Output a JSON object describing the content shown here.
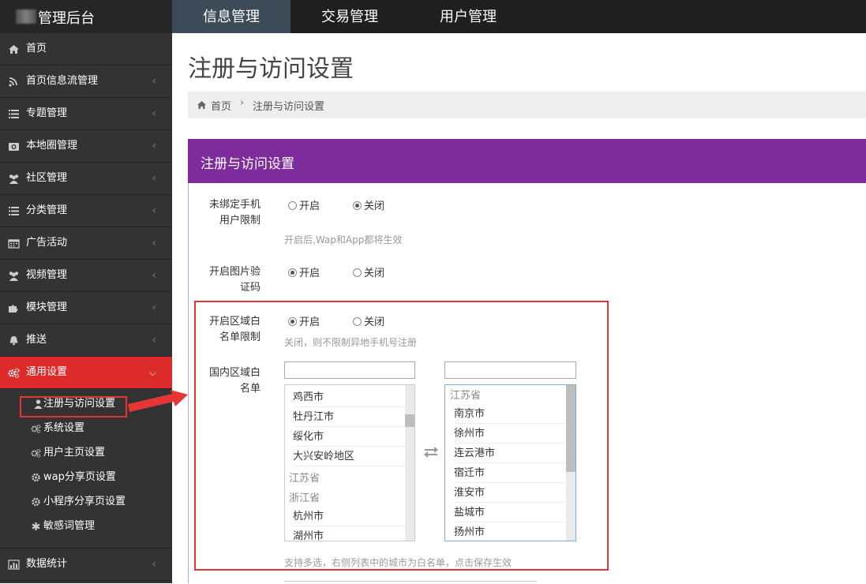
{
  "brand": {
    "title": "管理后台"
  },
  "topnav": [
    {
      "label": "信息管理",
      "active": true
    },
    {
      "label": "交易管理",
      "active": false
    },
    {
      "label": "用户管理",
      "active": false
    }
  ],
  "sidebar": {
    "items": [
      {
        "label": "首页",
        "icon": "home-icon"
      },
      {
        "label": "首页信息流管理",
        "icon": "rss-icon"
      },
      {
        "label": "专题管理",
        "icon": "list-icon"
      },
      {
        "label": "本地圈管理",
        "icon": "camera-icon"
      },
      {
        "label": "社区管理",
        "icon": "users-icon"
      },
      {
        "label": "分类管理",
        "icon": "list-icon"
      },
      {
        "label": "广告活动",
        "icon": "calendar-icon"
      },
      {
        "label": "视频管理",
        "icon": "users-icon"
      },
      {
        "label": "模块管理",
        "icon": "puzzle-icon"
      },
      {
        "label": "推送",
        "icon": "bell-icon"
      },
      {
        "label": "通用设置",
        "icon": "gears-icon",
        "active": true
      }
    ],
    "subitems": [
      {
        "label": "注册与访问设置",
        "icon": "user-icon",
        "current": true
      },
      {
        "label": "系统设置",
        "icon": "gears-icon"
      },
      {
        "label": "用户主页设置",
        "icon": "gears-icon"
      },
      {
        "label": "wap分享页设置",
        "icon": "gear-icon"
      },
      {
        "label": "小程序分享页设置",
        "icon": "gear-icon"
      },
      {
        "label": "敏感词管理",
        "icon": "asterisk-icon"
      }
    ],
    "bottom_item": {
      "label": "数据统计",
      "icon": "bar-chart-icon"
    }
  },
  "page": {
    "title": "注册与访问设置",
    "breadcrumb": {
      "home": "首页",
      "separator": "›",
      "current": "注册与访问设置"
    },
    "panel_title": "注册与访问设置"
  },
  "form": {
    "unbound_phone": {
      "label_line1": "未绑定手机",
      "label_line2": "用户限制",
      "options": [
        "开启",
        "关闭"
      ],
      "selected": "关闭",
      "hint": "开启后,Wap和App都将生效"
    },
    "captcha": {
      "label_line1": "开启图片验",
      "label_line2": "证码",
      "options": [
        "开启",
        "关闭"
      ],
      "selected": "开启"
    },
    "region_whitelist": {
      "label_line1": "开启区域白",
      "label_line2": "名单限制",
      "options": [
        "开启",
        "关闭"
      ],
      "selected": "开启",
      "hint": "关闭，则不限制异地手机号注册"
    },
    "domestic_whitelist": {
      "label_line1": "国内区域白",
      "label_line2": "名单",
      "left_list": [
        {
          "text": "鸡西市",
          "group": false
        },
        {
          "text": "牡丹江市",
          "group": false
        },
        {
          "text": "绥化市",
          "group": false
        },
        {
          "text": "大兴安岭地区",
          "group": false
        },
        {
          "text": "江苏省",
          "group": true
        },
        {
          "text": "浙江省",
          "group": true
        },
        {
          "text": "杭州市",
          "group": false
        },
        {
          "text": "湖州市",
          "group": false
        }
      ],
      "right_list": [
        {
          "text": "江苏省",
          "group": true
        },
        {
          "text": "南京市",
          "group": false
        },
        {
          "text": "徐州市",
          "group": false
        },
        {
          "text": "连云港市",
          "group": false
        },
        {
          "text": "宿迁市",
          "group": false
        },
        {
          "text": "淮安市",
          "group": false
        },
        {
          "text": "盐城市",
          "group": false
        },
        {
          "text": "扬州市",
          "group": false
        }
      ],
      "hint": "支持多选，右侧列表中的城市为白名单，点击保存生效"
    }
  },
  "colors": {
    "topbar": "#1f1f1f",
    "topnav_active": "#3d4b59",
    "sidebar": "#333333",
    "sidebar_active": "#dd2a2a",
    "panel_header": "#7e2b9c",
    "annotation": "#e53535"
  }
}
